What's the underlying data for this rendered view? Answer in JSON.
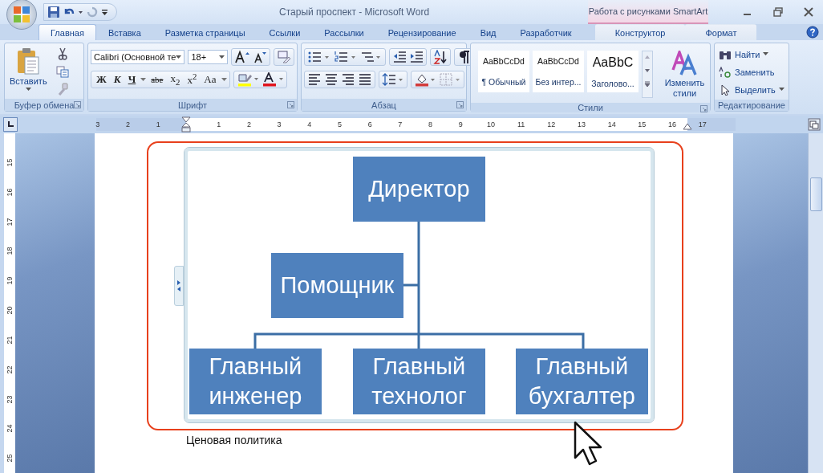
{
  "window": {
    "title": "Старый проспект - Microsoft Word",
    "context_title": "Работа с рисунками SmartArt"
  },
  "tabs": [
    {
      "label": "Главная",
      "selected": true,
      "contextual": false
    },
    {
      "label": "Вставка",
      "selected": false,
      "contextual": false
    },
    {
      "label": "Разметка страницы",
      "selected": false,
      "contextual": false
    },
    {
      "label": "Ссылки",
      "selected": false,
      "contextual": false
    },
    {
      "label": "Рассылки",
      "selected": false,
      "contextual": false
    },
    {
      "label": "Рецензирование",
      "selected": false,
      "contextual": false
    },
    {
      "label": "Вид",
      "selected": false,
      "contextual": false
    },
    {
      "label": "Разработчик",
      "selected": false,
      "contextual": false
    },
    {
      "label": "Конструктор",
      "selected": false,
      "contextual": true
    },
    {
      "label": "Формат",
      "selected": false,
      "contextual": true
    }
  ],
  "ribbon": {
    "clipboard": {
      "label": "Буфер обмена",
      "paste": "Вставить"
    },
    "font": {
      "label": "Шрифт",
      "font_name": "Calibri (Основной те",
      "font_size": "18+",
      "styles": [
        {
          "text": "Ж",
          "kind": "bold"
        },
        {
          "text": "К",
          "kind": "italic"
        },
        {
          "text": "Ч",
          "kind": "underline"
        },
        {
          "text": "abe",
          "kind": "strike"
        },
        {
          "text": "x$_{2}$",
          "kind": "sub"
        },
        {
          "text": "x$^{2}$",
          "kind": "sup"
        },
        {
          "text": "Aa",
          "kind": "case"
        }
      ]
    },
    "paragraph": {
      "label": "Абзац"
    },
    "styles": {
      "label": "Стили",
      "gallery": [
        {
          "sample": "AaBbCcDd",
          "name": "¶ Обычный",
          "kind": "normal"
        },
        {
          "sample": "AaBbCcDd",
          "name": "Без интер...",
          "kind": "normal"
        },
        {
          "sample": "AaBbC",
          "name": "Заголово...",
          "kind": "heading"
        }
      ],
      "change": "Изменить стили"
    },
    "editing": {
      "label": "Редактирование",
      "commands": [
        {
          "label": "Найти",
          "kind": "find"
        },
        {
          "label": "Заменить",
          "kind": "replace"
        },
        {
          "label": "Выделить",
          "kind": "select"
        }
      ]
    }
  },
  "ruler": {
    "horizontal": [
      "3",
      "2",
      "1",
      "1",
      "2",
      "3",
      "4",
      "5",
      "6",
      "7",
      "8",
      "9",
      "10",
      "11",
      "12",
      "13",
      "14",
      "15",
      "16",
      "17"
    ],
    "vertical": [
      "15",
      "16",
      "17",
      "18",
      "19",
      "20",
      "21",
      "22",
      "23",
      "24",
      "25"
    ]
  },
  "diagram": {
    "top": "Директор",
    "assistant": "Помощник",
    "subordinates": [
      "Главный инженер",
      "Главный технолог",
      "Главный бухгалтер"
    ],
    "highlighted": true
  },
  "document": {
    "paragraph": "Ценовая политика"
  }
}
